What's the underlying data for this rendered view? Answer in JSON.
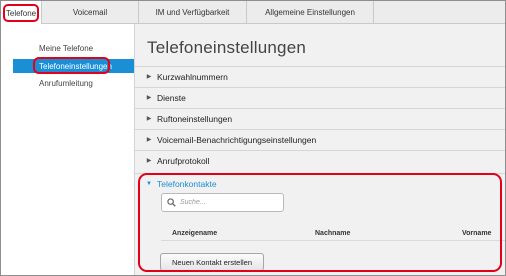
{
  "tabs": [
    {
      "label": "Telefone"
    },
    {
      "label": "Voicemail"
    },
    {
      "label": "IM und Verfügbarkeit"
    },
    {
      "label": "Allgemeine Einstellungen"
    }
  ],
  "sidebar": {
    "items": [
      {
        "label": "Meine Telefone"
      },
      {
        "label": "Telefoneinstellungen"
      },
      {
        "label": "Anrufumleitung"
      }
    ]
  },
  "main": {
    "title": "Telefoneinstellungen",
    "sections": [
      {
        "label": "Kurzwahlnummern"
      },
      {
        "label": "Dienste"
      },
      {
        "label": "Ruftoneinstellungen"
      },
      {
        "label": "Voicemail-Benachrichtigungseinstellungen"
      },
      {
        "label": "Anrufprotokoll"
      },
      {
        "label": "Telefonkontakte"
      }
    ],
    "contacts": {
      "search_placeholder": "Suche...",
      "columns": [
        "Anzeigename",
        "Nachname",
        "Vorname"
      ],
      "create_button": "Neuen Kontakt erstellen"
    }
  },
  "colors": {
    "accent": "#1a8fd6",
    "highlight": "#e2001a"
  }
}
